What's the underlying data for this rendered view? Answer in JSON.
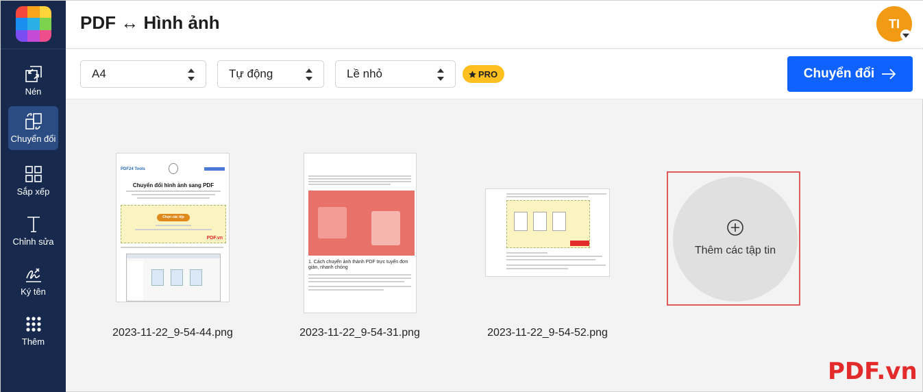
{
  "header": {
    "title": "PDF ↔ Hình ảnh",
    "avatar_initials": "TI"
  },
  "sidebar": {
    "items": [
      {
        "label": "Nén",
        "icon": "compress-icon"
      },
      {
        "label": "Chuyển đổi",
        "icon": "convert-icon",
        "active": true
      },
      {
        "label": "Sắp xếp",
        "icon": "grid-icon"
      },
      {
        "label": "Chỉnh sửa",
        "icon": "text-edit-icon"
      },
      {
        "label": "Ký tên",
        "icon": "signature-icon"
      },
      {
        "label": "Thêm",
        "icon": "dots-grid-icon"
      }
    ]
  },
  "toolbar": {
    "page_size": "A4",
    "orientation": "Tự động",
    "margin": "Lề nhỏ",
    "pro_badge": "PRO",
    "convert_label": "Chuyển đổi"
  },
  "files": [
    {
      "name": "2023-11-22_9-54-44.png"
    },
    {
      "name": "2023-11-22_9-54-31.png"
    },
    {
      "name": "2023-11-22_9-54-52.png"
    }
  ],
  "thumb1": {
    "brand": "PDF24 Tools",
    "heading": "Chuyển đổi hình ảnh sang PDF",
    "button": "Chọn các tệp",
    "logo": "PDF.vn"
  },
  "thumb2": {
    "caption": "1. Cách chuyển ảnh thành PDF trực tuyến đơn giản, nhanh chóng"
  },
  "add_files": {
    "label": "Thêm các tập tin"
  },
  "watermark": "PDF.vn",
  "colors": {
    "sidebar": "#17294d",
    "accent": "#0f62fe",
    "pro": "#ffbf1f",
    "avatar": "#f29a13",
    "highlight_box": "#e05a5a"
  }
}
